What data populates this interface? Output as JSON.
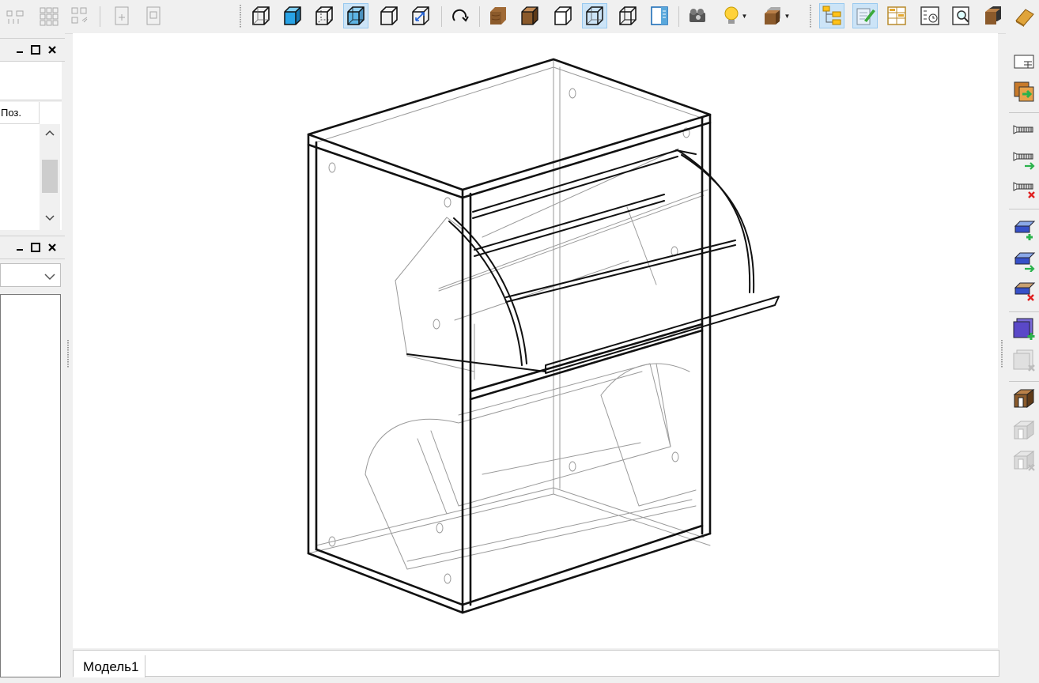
{
  "toolbar": {
    "groups": [
      [
        "align-objects-icon",
        "array-grid-icon",
        "distribute-icon",
        "export-doc-icon",
        "import-doc-icon"
      ],
      [
        "view-wireframe-icon",
        "view-shaded-icon",
        "view-hidden-lines-icon",
        "view-xray-icon",
        "view-outline-icon",
        "fit-view-icon"
      ],
      [
        "rotate-view-icon"
      ],
      [
        "wood-texture-icon",
        "solid-brown-icon",
        "white-solid-icon",
        "transparent-solid-icon",
        "edges-solid-icon",
        "split-panel-icon"
      ],
      [
        "camera-icon",
        "light-bulb-icon",
        "materials-icon"
      ],
      [
        "tree-structure-icon",
        "edit-notes-icon",
        "grid-list-icon",
        "schedule-icon",
        "zoom-preview-icon",
        "part-cube-icon",
        "panel-layer-icon"
      ]
    ],
    "active": [
      "view-xray-icon",
      "transparent-solid-icon",
      "tree-structure-icon",
      "edit-notes-icon"
    ]
  },
  "left_panel": {
    "position_header": "Поз.",
    "combo_value": ""
  },
  "right_toolbar": [
    "panel-table-icon",
    "export-panel-icon",
    "screw-icon",
    "screw-add-icon",
    "screw-remove-icon",
    "edge-band-add-icon",
    "edge-band-apply-icon",
    "edge-band-remove-icon",
    "cutout-add-icon",
    "cutout-remove-icon",
    "groove-icon",
    "groove-apply-icon",
    "groove-remove-icon"
  ],
  "colors": {
    "background": "#f0f0f0",
    "viewport": "#ffffff",
    "active_button": "#cce4f7",
    "icon_blue": "#29a3e6",
    "wood": "#8b5a2b",
    "add_green": "#2bb24c",
    "remove_red": "#e02020"
  },
  "tabs": [
    {
      "label": "Модель1"
    }
  ]
}
